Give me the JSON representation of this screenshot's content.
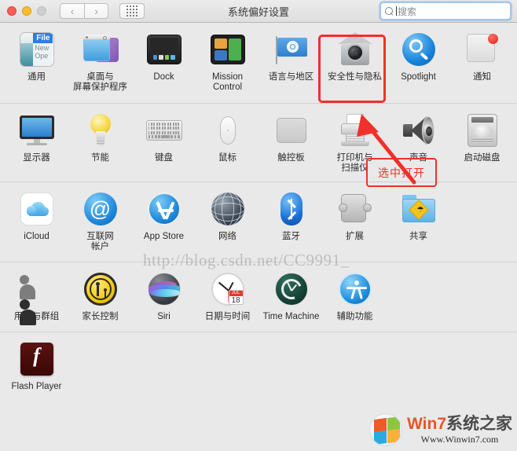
{
  "window": {
    "title": "系统偏好设置",
    "traffic_lights": [
      "close",
      "minimize",
      "zoom"
    ],
    "nav_back": "‹",
    "nav_forward": "›",
    "grid_button": "show-all-grid"
  },
  "search": {
    "placeholder": "搜索",
    "value": "",
    "icon": "search-icon",
    "focused": true
  },
  "rows": [
    {
      "id": "row-personal",
      "items": [
        {
          "name": "general",
          "label": "通用",
          "icon": "general-icon",
          "icon_text": {
            "file": "File",
            "new": "New",
            "open": "Ope"
          }
        },
        {
          "name": "desktop-screensaver",
          "label": "桌面与\n屏幕保护程序",
          "icon": "desktop-screensaver-icon"
        },
        {
          "name": "dock",
          "label": "Dock",
          "icon": "dock-icon"
        },
        {
          "name": "mission-control",
          "label": "Mission\nControl",
          "icon": "mission-control-icon"
        },
        {
          "name": "language-region",
          "label": "语言与地区",
          "icon": "language-region-icon"
        },
        {
          "name": "security-privacy",
          "label": "安全性与隐私",
          "icon": "security-privacy-icon",
          "highlighted": true
        },
        {
          "name": "spotlight",
          "label": "Spotlight",
          "icon": "spotlight-icon"
        },
        {
          "name": "notifications",
          "label": "通知",
          "icon": "notifications-icon"
        }
      ]
    },
    {
      "id": "row-hardware",
      "items": [
        {
          "name": "displays",
          "label": "显示器",
          "icon": "display-icon"
        },
        {
          "name": "energy-saver",
          "label": "节能",
          "icon": "lightbulb-icon"
        },
        {
          "name": "keyboard",
          "label": "键盘",
          "icon": "keyboard-icon"
        },
        {
          "name": "mouse",
          "label": "鼠标",
          "icon": "mouse-icon"
        },
        {
          "name": "trackpad",
          "label": "触控板",
          "icon": "trackpad-icon"
        },
        {
          "name": "printers-scanners",
          "label": "打印机与\n扫描仪",
          "icon": "printer-icon"
        },
        {
          "name": "sound",
          "label": "声音",
          "icon": "speaker-icon"
        },
        {
          "name": "startup-disk",
          "label": "启动磁盘",
          "icon": "harddisk-icon"
        }
      ]
    },
    {
      "id": "row-internet",
      "items": [
        {
          "name": "icloud",
          "label": "iCloud",
          "icon": "icloud-icon"
        },
        {
          "name": "internet-accounts",
          "label": "互联网\n帐户",
          "icon": "at-sign-icon"
        },
        {
          "name": "app-store",
          "label": "App Store",
          "icon": "app-store-icon"
        },
        {
          "name": "network",
          "label": "网络",
          "icon": "globe-icon"
        },
        {
          "name": "bluetooth",
          "label": "蓝牙",
          "icon": "bluetooth-icon"
        },
        {
          "name": "extensions",
          "label": "扩展",
          "icon": "puzzle-piece-icon"
        },
        {
          "name": "sharing",
          "label": "共享",
          "icon": "sharing-folder-icon"
        }
      ]
    },
    {
      "id": "row-system",
      "items": [
        {
          "name": "users-groups",
          "label": "用户与群组",
          "icon": "users-icon"
        },
        {
          "name": "parental-controls",
          "label": "家长控制",
          "icon": "parental-controls-icon"
        },
        {
          "name": "siri",
          "label": "Siri",
          "icon": "siri-icon"
        },
        {
          "name": "date-time",
          "label": "日期与时间",
          "icon": "clock-calendar-icon",
          "icon_text": {
            "month": "JUL",
            "day": "18"
          }
        },
        {
          "name": "time-machine",
          "label": "Time Machine",
          "icon": "time-machine-icon"
        },
        {
          "name": "accessibility",
          "label": "辅助功能",
          "icon": "accessibility-icon"
        }
      ]
    },
    {
      "id": "row-other",
      "items": [
        {
          "name": "flash-player",
          "label": "Flash Player",
          "icon": "flash-player-icon",
          "icon_text": {
            "glyph": "f"
          }
        }
      ]
    }
  ],
  "annotations": {
    "highlight_target": "安全性与隐私",
    "callout_label": "选中打开",
    "accent_color": "#f0302a"
  },
  "watermark": {
    "text": "http://blog.csdn.net/CC9991_"
  },
  "brand": {
    "name_colored": "Win7",
    "name_dark": "系统之家",
    "url": "Www.Winwin7.com"
  }
}
